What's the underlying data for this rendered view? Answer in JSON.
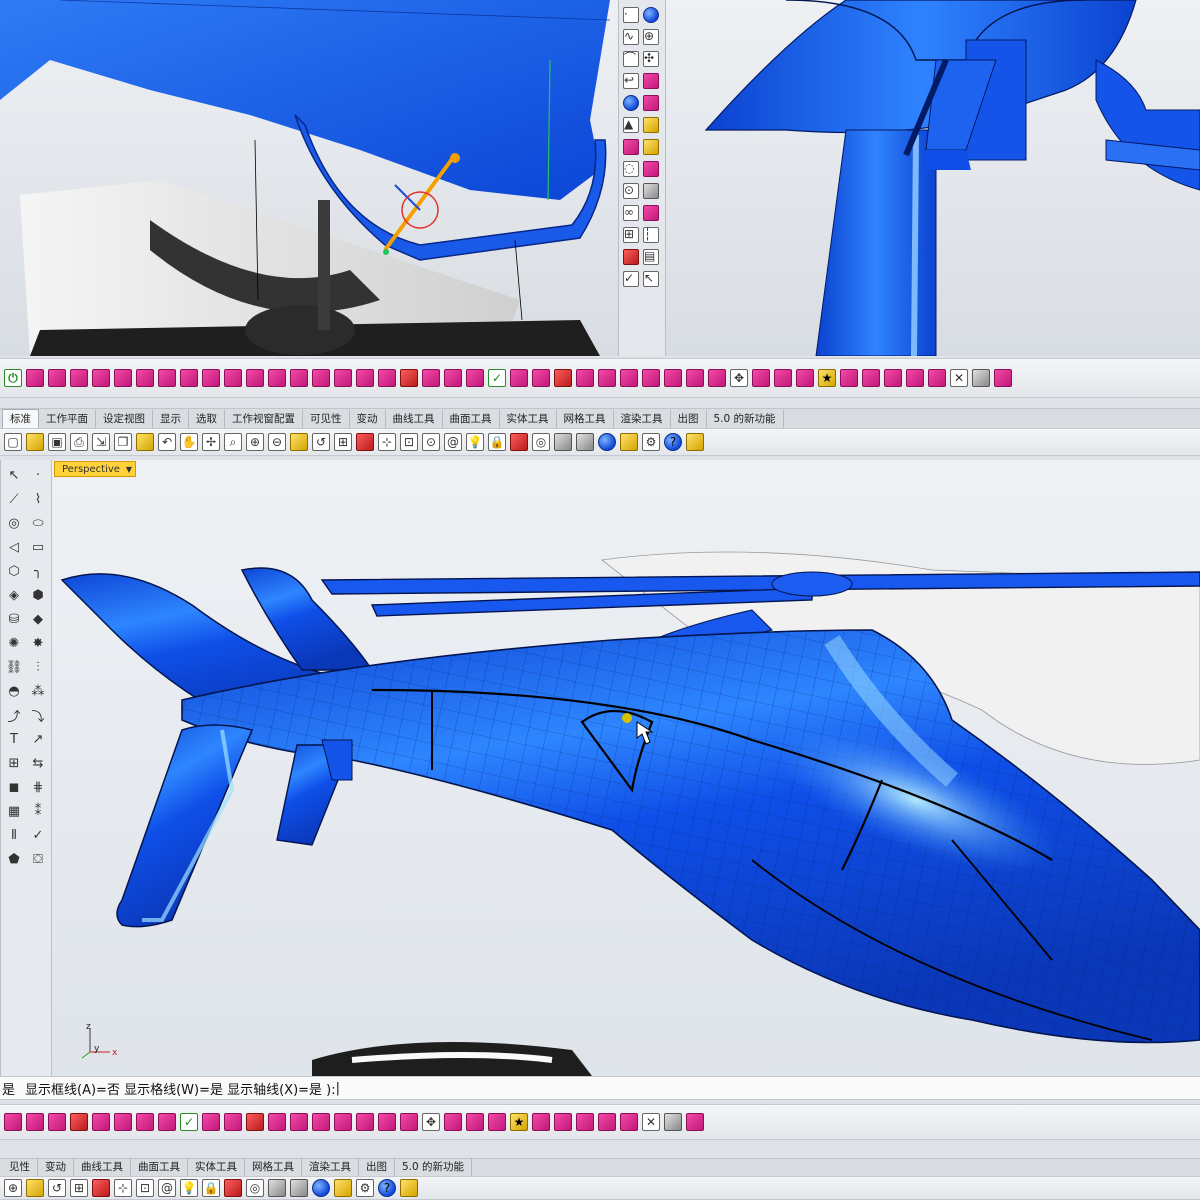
{
  "command_line": {
    "prefix": "是",
    "text": "显示框线(A)=否  显示格线(W)=是  显示轴线(X)=是 ):",
    "cursor": "|"
  },
  "main_tabs": [
    "标准",
    "工作平面",
    "设定视图",
    "显示",
    "选取",
    "工作视窗配置",
    "可见性",
    "变动",
    "曲线工具",
    "曲面工具",
    "实体工具",
    "网格工具",
    "渲染工具",
    "出图",
    "5.0 的新功能"
  ],
  "bottom_tabs": [
    "见性",
    "变动",
    "曲线工具",
    "曲面工具",
    "实体工具",
    "网格工具",
    "渲染工具",
    "出图",
    "5.0 的新功能"
  ],
  "viewport": {
    "label": "Perspective",
    "axis_labels": {
      "z": "z",
      "y": "y",
      "x": "x"
    }
  },
  "colors": {
    "model_blue": "#0f4fe8",
    "accent_magenta": "#d21e8c",
    "label_yellow": "#ffd23a"
  }
}
